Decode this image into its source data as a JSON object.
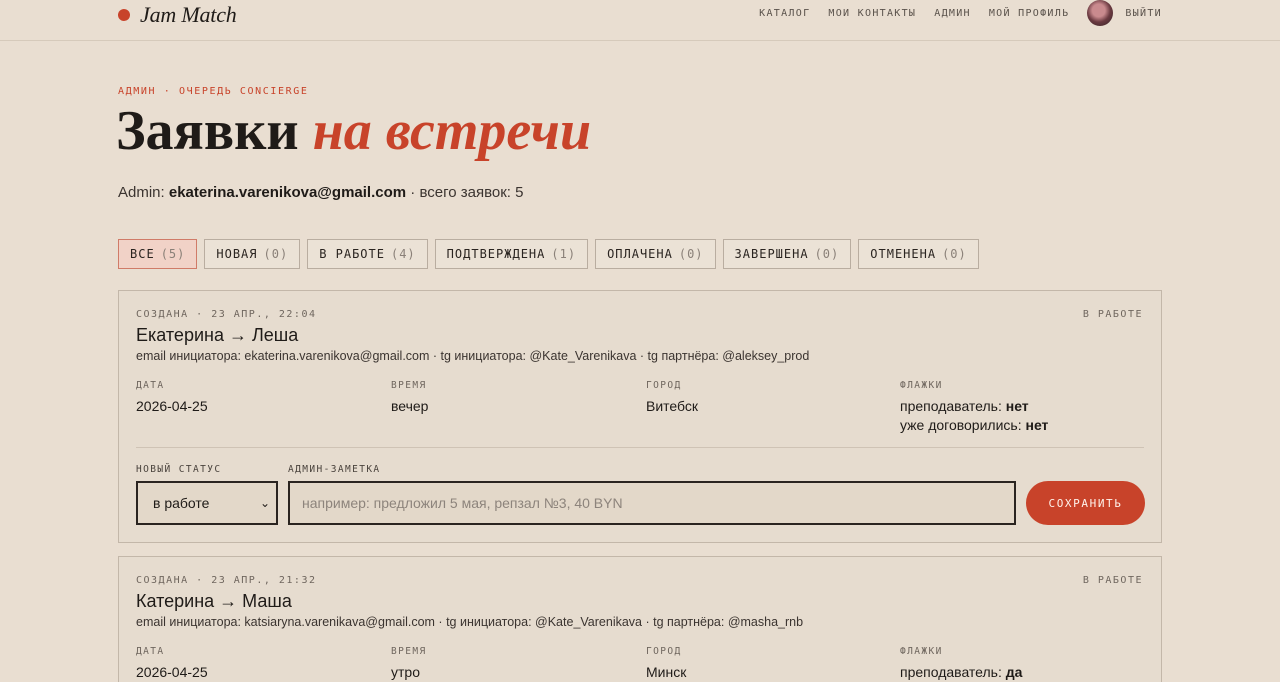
{
  "header": {
    "brand": "Jam Match",
    "nav": [
      "КАТАЛОГ",
      "МОИ КОНТАКТЫ",
      "АДМИН",
      "МОЙ ПРОФИЛЬ"
    ],
    "logout": "ВЫЙТИ"
  },
  "page": {
    "eyebrow": "АДМИН · ОЧЕРЕДЬ CONCIERGE",
    "title_main": "Заявки",
    "title_accent": "на встречи",
    "admin_prefix": "Admin:",
    "admin_email": "ekaterina.varenikova@gmail.com",
    "admin_suffix": "· всего заявок: 5"
  },
  "filters": [
    {
      "label": "ВСЕ",
      "count": "(5)"
    },
    {
      "label": "НОВАЯ",
      "count": "(0)"
    },
    {
      "label": "В РАБОТЕ",
      "count": "(4)"
    },
    {
      "label": "ПОДТВЕРЖДЕНА",
      "count": "(1)"
    },
    {
      "label": "ОПЛАЧЕНА",
      "count": "(0)"
    },
    {
      "label": "ЗАВЕРШЕНА",
      "count": "(0)"
    },
    {
      "label": "ОТМЕНЕНА",
      "count": "(0)"
    }
  ],
  "labels": {
    "date": "ДАТА",
    "time": "ВРЕМЯ",
    "city": "ГОРОД",
    "flags": "ФЛАЖКИ",
    "new_status": "НОВЫЙ СТАТУС",
    "admin_note": "АДМИН-ЗАМЕТКА",
    "teacher": "преподаватель:",
    "agreed": "уже договорились:",
    "save": "СОХРАНИТЬ",
    "note_placeholder": "например: предложил 5 мая, репзал №3, 40 BYN"
  },
  "requests": [
    {
      "created": "СОЗДАНА · 23 АПР., 22:04",
      "status": "В РАБОТЕ",
      "title": "Екатерина → Леша",
      "contacts": "email инициатора: ekaterina.varenikova@gmail.com · tg инициатора: @Kate_Varenikava · tg партнёра: @aleksey_prod",
      "date": "2026-04-25",
      "time": "вечер",
      "city": "Витебск",
      "teacher": "нет",
      "agreed": "нет",
      "select_value": "в работе"
    },
    {
      "created": "СОЗДАНА · 23 АПР., 21:32",
      "status": "В РАБОТЕ",
      "title": "Катерина → Маша",
      "contacts": "email инициатора: katsiaryna.varenikava@gmail.com · tg инициатора: @Kate_Varenikava · tg партнёра: @masha_rnb",
      "date": "2026-04-25",
      "time": "утро",
      "city": "Минск",
      "teacher": "да"
    }
  ]
}
